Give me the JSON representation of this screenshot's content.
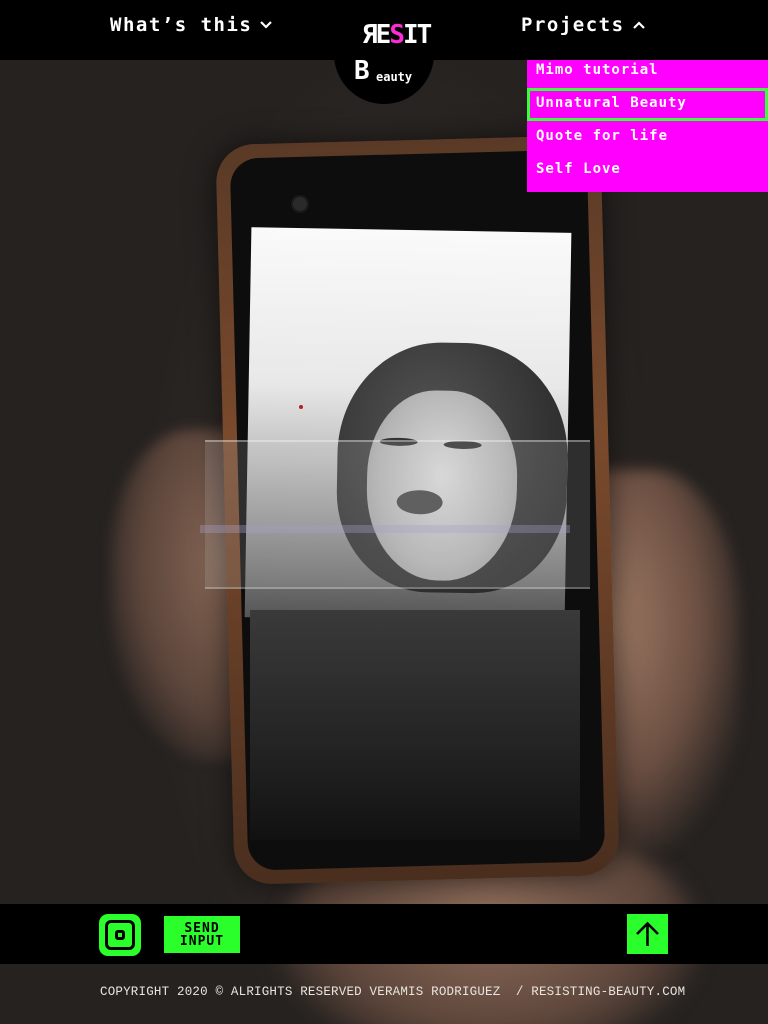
{
  "nav": {
    "whats_this": "What’s this",
    "projects": "Projects"
  },
  "logo": {
    "line1_a": "ЯE",
    "line1_b": "S",
    "line1_c": "IT",
    "line2": "B",
    "line3": "eauty"
  },
  "projects_menu": {
    "items": [
      {
        "label": "Mimo tutorial"
      },
      {
        "label": "Unnatural Beauty",
        "active": true
      },
      {
        "label": "Quote for life"
      },
      {
        "label": "Self Love"
      }
    ]
  },
  "footer": {
    "send_line1": "SEND",
    "send_line2": "INPUT",
    "copyright": "COPYRIGHT 2020 © ALRIGHTS RESERVED VERAMIS RODRIGUEZ  / RESISTING-BEAUTY.COM"
  },
  "icons": {
    "instagram": "instagram-icon",
    "back_to_top": "arrow-up-icon",
    "chevron_down": "chevron-down-icon",
    "chevron_up": "chevron-up-icon"
  },
  "colors": {
    "accent_green": "#2bff2b",
    "menu_magenta": "#ff00ff",
    "logo_pink": "#ff2bd6",
    "bar_black": "#000000"
  }
}
